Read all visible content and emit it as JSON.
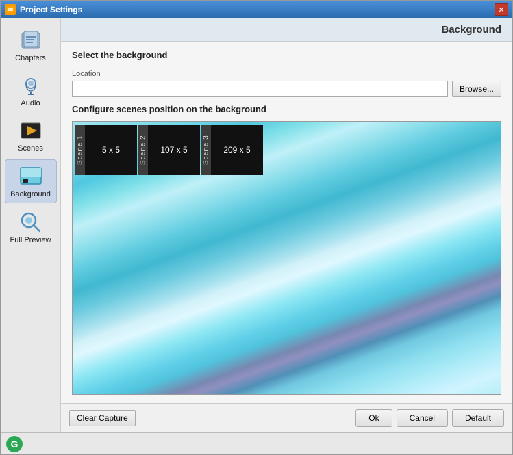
{
  "window": {
    "title": "Project Settings",
    "icon": "⚙"
  },
  "header": {
    "section_title": "Background"
  },
  "sidebar": {
    "items": [
      {
        "id": "chapters",
        "label": "Chapters",
        "icon": "chapters-icon",
        "active": false
      },
      {
        "id": "audio",
        "label": "Audio",
        "icon": "audio-icon",
        "active": false
      },
      {
        "id": "scenes",
        "label": "Scenes",
        "icon": "scenes-icon",
        "active": false
      },
      {
        "id": "background",
        "label": "Background",
        "icon": "background-icon",
        "active": true
      },
      {
        "id": "full-preview",
        "label": "Full Preview",
        "icon": "full-preview-icon",
        "active": false
      }
    ]
  },
  "content": {
    "select_background_title": "Select the background",
    "location_label": "Location",
    "location_value": "",
    "location_placeholder": "",
    "browse_label": "Browse...",
    "configure_title": "Configure scenes position on the background",
    "scenes": [
      {
        "label": "Scene 1",
        "coords": "5 x  5"
      },
      {
        "label": "Scene 2",
        "coords": "107 x  5"
      },
      {
        "label": "Scene 3",
        "coords": "209 x  5"
      }
    ]
  },
  "footer": {
    "clear_capture_label": "Clear Capture",
    "ok_label": "Ok",
    "cancel_label": "Cancel",
    "default_label": "Default"
  }
}
